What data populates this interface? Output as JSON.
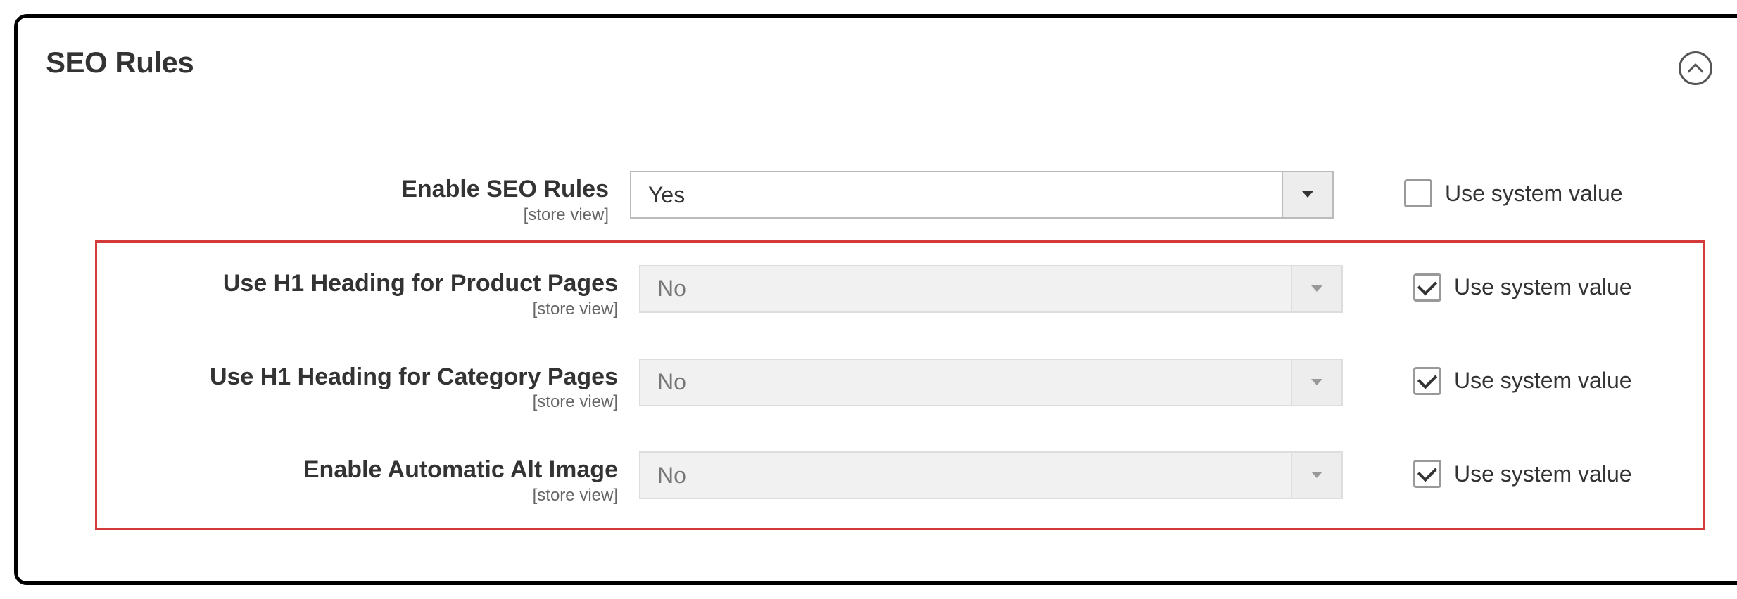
{
  "section": {
    "title": "SEO Rules"
  },
  "common": {
    "use_system_value": "Use system value",
    "scope": "[store view]"
  },
  "fields": {
    "enable_seo_rules": {
      "label": "Enable SEO Rules",
      "value": "Yes",
      "use_system": false,
      "disabled": false
    },
    "h1_product": {
      "label": "Use H1 Heading for Product Pages",
      "value": "No",
      "use_system": true,
      "disabled": true
    },
    "h1_category": {
      "label": "Use H1 Heading for Category Pages",
      "value": "No",
      "use_system": true,
      "disabled": true
    },
    "auto_alt_image": {
      "label": "Enable Automatic Alt Image",
      "value": "No",
      "use_system": true,
      "disabled": true
    }
  }
}
